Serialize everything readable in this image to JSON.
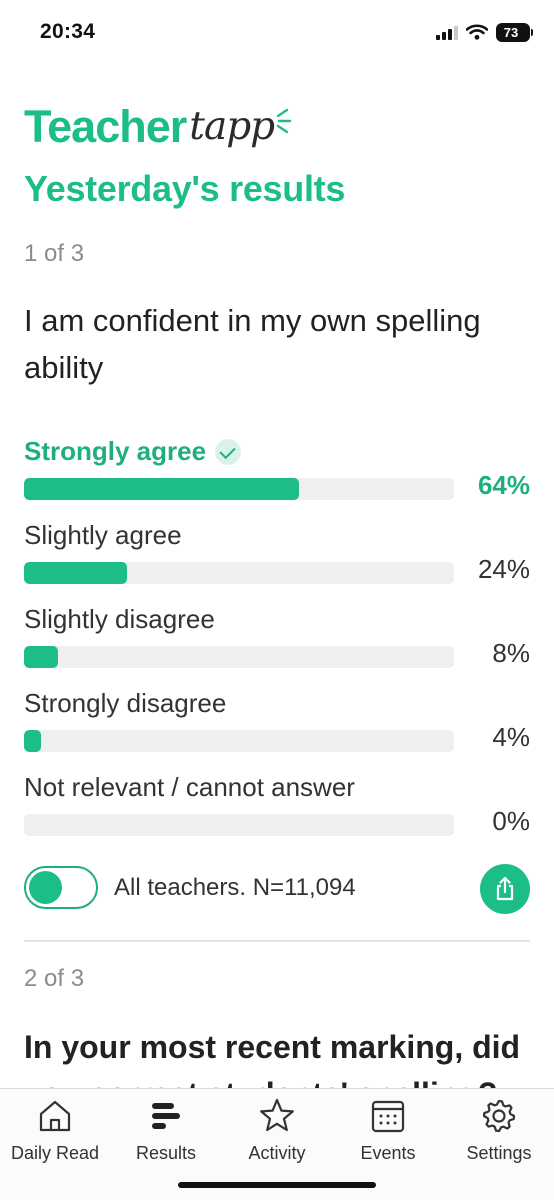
{
  "status_bar": {
    "time": "20:34",
    "battery": "73",
    "icons": [
      "signal-icon",
      "wifi-icon",
      "battery-icon"
    ]
  },
  "brand": {
    "main": "Teacher",
    "script": "tapp"
  },
  "page_title": "Yesterday's results",
  "question1": {
    "counter": "1 of 3",
    "text": "I am confident in my own spelling ability",
    "answers": [
      {
        "label": "Strongly agree",
        "pct": "64%",
        "value": 64,
        "selected": true
      },
      {
        "label": "Slightly agree",
        "pct": "24%",
        "value": 24,
        "selected": false
      },
      {
        "label": "Slightly disagree",
        "pct": "8%",
        "value": 8,
        "selected": false
      },
      {
        "label": "Strongly disagree",
        "pct": "4%",
        "value": 4,
        "selected": false
      },
      {
        "label": "Not relevant / cannot answer",
        "pct": "0%",
        "value": 0,
        "selected": false
      }
    ],
    "filter_label": "All teachers. N=11,094",
    "filter_on": true
  },
  "question2": {
    "counter": "2 of 3",
    "text": "In your most recent marking, did you correct students' spelling?"
  },
  "tabs": [
    {
      "label": "Daily Read",
      "icon": "home-icon"
    },
    {
      "label": "Results",
      "icon": "results-icon"
    },
    {
      "label": "Activity",
      "icon": "star-icon"
    },
    {
      "label": "Events",
      "icon": "calendar-icon"
    },
    {
      "label": "Settings",
      "icon": "gear-icon"
    }
  ],
  "colors": {
    "accent": "#1dbd8a",
    "accent_text": "#1fae80",
    "track": "#efefef",
    "muted": "#8c8c8c"
  }
}
